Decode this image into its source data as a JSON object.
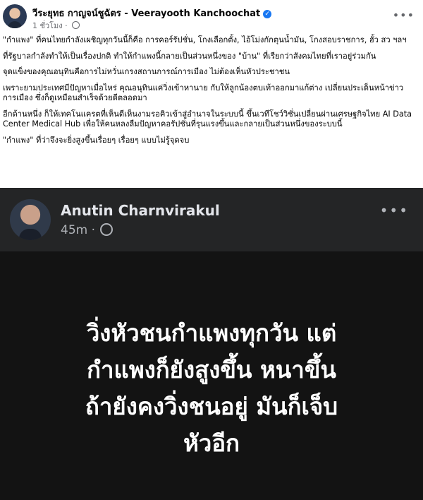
{
  "post": {
    "author": "วีระยุทธ กาญจน์ชูฉัตร - Veerayooth Kanchoochat",
    "verified_mark": "✓",
    "time": "1 ชั่วโมง",
    "meta_separator": "·",
    "more_icon": "•••",
    "paragraphs": [
      "\"กำแพง\" ที่คนไทยกำลังเผชิญทุกวันนี้ก็คือ การคอร์รัปชั่น, โกงเลือกตั้ง, ไอ้โม่งกักตุนน้ำมัน, โกงสอบราชการ, ฮั้ว สว ฯลฯ",
      "ที่รัฐบาลกำลังทำให้เป็นเรื่องปกติ ทำให้กำแพงนี้กลายเป็นส่วนหนึ่งของ \"บ้าน\" ที่เรียกว่าสังคมไทยที่เราอยู่ร่วมกัน",
      "จุดแข็งของคุณอนุทินคือการไม่หวั่นเกรงสถานการณ์การเมือง ไม่ต้องเห็นหัวประชาชน",
      "เพราะยามประเทศมีปัญหาเมื่อไหร่ คุณอนุทินแค่วิ่งเข้าหานาย กับให้ลูกน้องตบเท้าออกมาแก้ต่าง เปลี่ยนประเด็นหน้าข่าวการเมือง ซึ่งก็ดูเหมือนสำเร็จด้วยดีตลอดมา",
      "อีกด้านหนึ่ง ก็ให้เทคโนแครตที่เห็นดีเห็นงามรอคิวเข้าสู่อำนาจในระบบนี้ ขึ้นเวทีโชว์วิชั่นเปลี่ยนผ่านเศรษฐกิจไทย AI Data Center Medical Hub เพื่อให้คนหลงลืมปัญหาคอรัปชั่นที่รุนแรงขึ้นและกลายเป็นส่วนหนึ่งของระบบนี้",
      "\"กำแพง\" ที่ว่าจึงจะยิ่งสูงขึ้นเรื่อยๆ เรื่อยๆ แบบไม่รู้จุดจบ"
    ]
  },
  "screenshot": {
    "name": "Anutin Charnvirakul",
    "time": "45m",
    "meta_separator": "·",
    "more_icon": "•••",
    "lines": [
      "วิ่งหัวชนกำแพงทุกวัน แต่",
      "กำแพงก็ยังสูงขึ้น หนาขึ้น",
      "ถ้ายังคงวิ่งชนอยู่ มันก็เจ็บ",
      "หัวอีก"
    ]
  },
  "colors": {
    "verified": "#1877f2",
    "dark_bg": "#131313",
    "dark_header": "#242526"
  }
}
